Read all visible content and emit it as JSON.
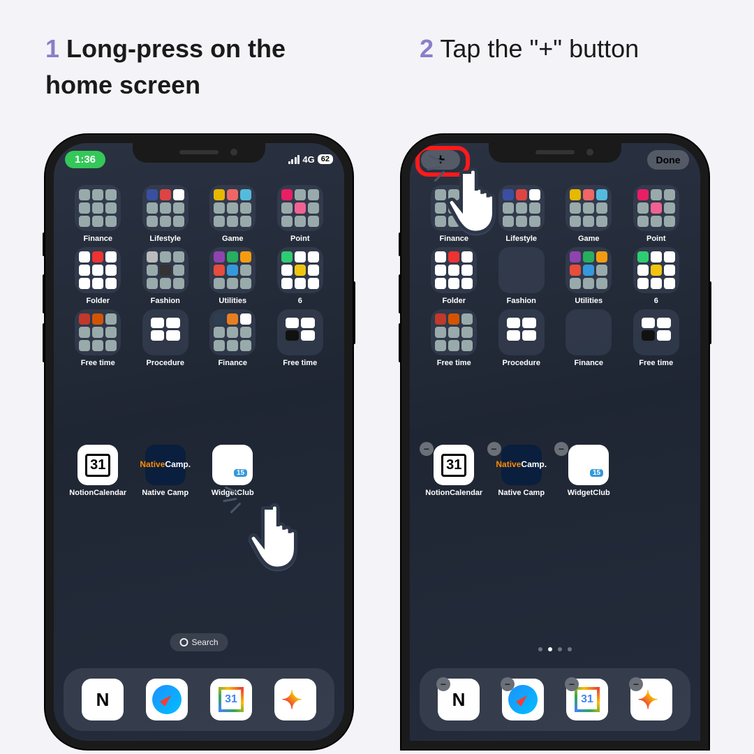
{
  "step1": {
    "num": "1",
    "text": "Long-press on the home screen"
  },
  "step2": {
    "num": "2",
    "text": "Tap the \"+\" button"
  },
  "status": {
    "time": "1:36",
    "net": "4G",
    "battery": "62"
  },
  "edit": {
    "plus": "+",
    "done": "Done"
  },
  "folders": [
    {
      "label": "Finance",
      "style": "c1"
    },
    {
      "label": "Lifestyle",
      "style": "c2"
    },
    {
      "label": "Game",
      "style": "c3"
    },
    {
      "label": "Point",
      "style": "c4"
    },
    {
      "label": "Folder",
      "style": "c5"
    },
    {
      "label": "Fashion",
      "style": "c6"
    },
    {
      "label": "Utilities",
      "style": "c7"
    },
    {
      "label": "6",
      "style": "c8"
    },
    {
      "label": "Free time",
      "style": "c9"
    },
    {
      "label": "Procedure",
      "style": "c10"
    },
    {
      "label": "Finance",
      "style": "c11"
    },
    {
      "label": "Free time",
      "style": "c12"
    }
  ],
  "emptyFolders": [
    5,
    10
  ],
  "apps": [
    {
      "label": "NotionCalendar",
      "icon": "notioncal",
      "text": "31"
    },
    {
      "label": "Native Camp",
      "icon": "native"
    },
    {
      "label": "WidgetClub",
      "icon": "wc",
      "badge": "15"
    }
  ],
  "search": "Search",
  "dock": [
    {
      "name": "notion",
      "text": "N"
    },
    {
      "name": "safari"
    },
    {
      "name": "gcal",
      "text": "31"
    },
    {
      "name": "claude"
    }
  ]
}
